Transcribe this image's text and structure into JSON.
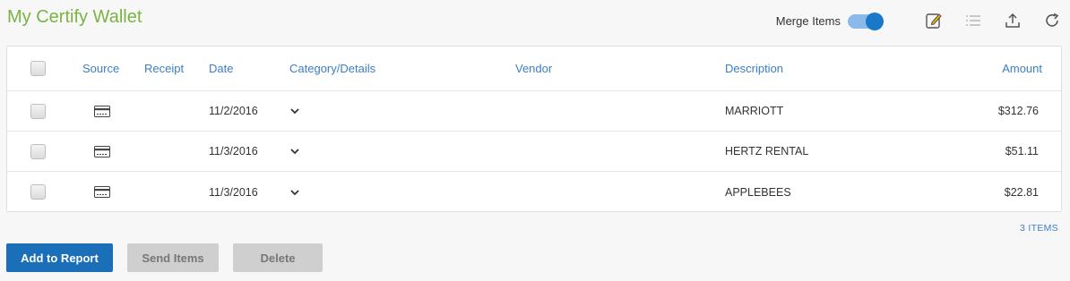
{
  "page": {
    "title": "My Certify Wallet"
  },
  "toolbar": {
    "merge_label": "Merge Items",
    "merge_enabled": true,
    "icons": [
      "edit-icon",
      "list-icon",
      "upload-icon",
      "refresh-icon"
    ]
  },
  "table": {
    "headers": {
      "source": "Source",
      "receipt": "Receipt",
      "date": "Date",
      "category": "Category/Details",
      "vendor": "Vendor",
      "description": "Description",
      "amount": "Amount"
    },
    "rows": [
      {
        "source_icon": "credit-card-icon",
        "receipt": "",
        "date": "11/2/2016",
        "vendor": "",
        "description": "MARRIOTT",
        "amount": "$312.76"
      },
      {
        "source_icon": "credit-card-icon",
        "receipt": "",
        "date": "11/3/2016",
        "vendor": "",
        "description": "HERTZ RENTAL",
        "amount": "$51.11"
      },
      {
        "source_icon": "credit-card-icon",
        "receipt": "",
        "date": "11/3/2016",
        "vendor": "",
        "description": "APPLEBEES",
        "amount": "$22.81"
      }
    ]
  },
  "footer": {
    "items_count": "3 ITEMS"
  },
  "actions": {
    "add_to_report": "Add to Report",
    "send_items": "Send Items",
    "delete": "Delete"
  },
  "colors": {
    "title": "#7ab342",
    "link": "#3b7fc4",
    "primary": "#1a6fb8",
    "disabled": "#cfcfcf"
  }
}
